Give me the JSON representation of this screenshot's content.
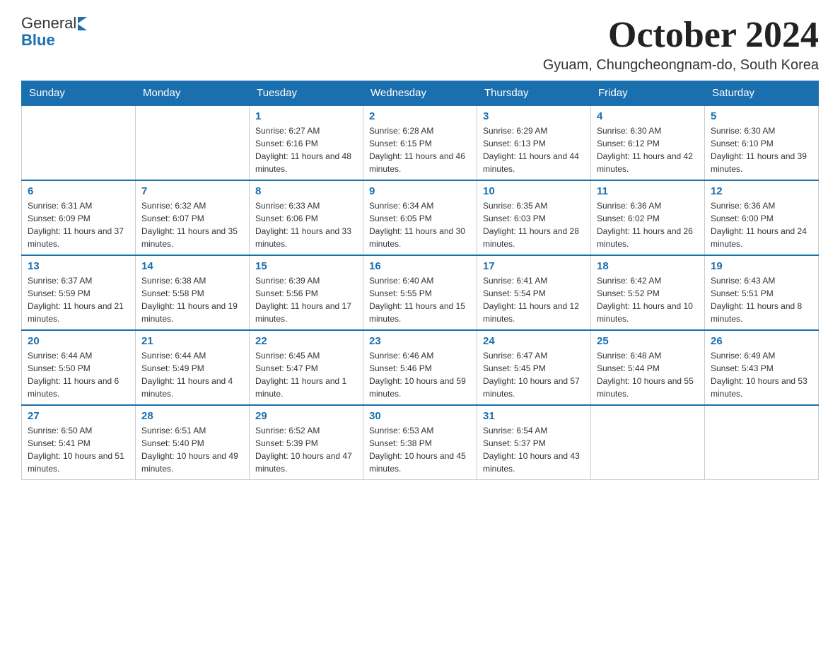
{
  "header": {
    "logo_general": "General",
    "logo_blue": "Blue",
    "main_title": "October 2024",
    "subtitle": "Gyuam, Chungcheongnam-do, South Korea"
  },
  "calendar": {
    "days_of_week": [
      "Sunday",
      "Monday",
      "Tuesday",
      "Wednesday",
      "Thursday",
      "Friday",
      "Saturday"
    ],
    "weeks": [
      [
        {
          "day": "",
          "sunrise": "",
          "sunset": "",
          "daylight": ""
        },
        {
          "day": "",
          "sunrise": "",
          "sunset": "",
          "daylight": ""
        },
        {
          "day": "1",
          "sunrise": "Sunrise: 6:27 AM",
          "sunset": "Sunset: 6:16 PM",
          "daylight": "Daylight: 11 hours and 48 minutes."
        },
        {
          "day": "2",
          "sunrise": "Sunrise: 6:28 AM",
          "sunset": "Sunset: 6:15 PM",
          "daylight": "Daylight: 11 hours and 46 minutes."
        },
        {
          "day": "3",
          "sunrise": "Sunrise: 6:29 AM",
          "sunset": "Sunset: 6:13 PM",
          "daylight": "Daylight: 11 hours and 44 minutes."
        },
        {
          "day": "4",
          "sunrise": "Sunrise: 6:30 AM",
          "sunset": "Sunset: 6:12 PM",
          "daylight": "Daylight: 11 hours and 42 minutes."
        },
        {
          "day": "5",
          "sunrise": "Sunrise: 6:30 AM",
          "sunset": "Sunset: 6:10 PM",
          "daylight": "Daylight: 11 hours and 39 minutes."
        }
      ],
      [
        {
          "day": "6",
          "sunrise": "Sunrise: 6:31 AM",
          "sunset": "Sunset: 6:09 PM",
          "daylight": "Daylight: 11 hours and 37 minutes."
        },
        {
          "day": "7",
          "sunrise": "Sunrise: 6:32 AM",
          "sunset": "Sunset: 6:07 PM",
          "daylight": "Daylight: 11 hours and 35 minutes."
        },
        {
          "day": "8",
          "sunrise": "Sunrise: 6:33 AM",
          "sunset": "Sunset: 6:06 PM",
          "daylight": "Daylight: 11 hours and 33 minutes."
        },
        {
          "day": "9",
          "sunrise": "Sunrise: 6:34 AM",
          "sunset": "Sunset: 6:05 PM",
          "daylight": "Daylight: 11 hours and 30 minutes."
        },
        {
          "day": "10",
          "sunrise": "Sunrise: 6:35 AM",
          "sunset": "Sunset: 6:03 PM",
          "daylight": "Daylight: 11 hours and 28 minutes."
        },
        {
          "day": "11",
          "sunrise": "Sunrise: 6:36 AM",
          "sunset": "Sunset: 6:02 PM",
          "daylight": "Daylight: 11 hours and 26 minutes."
        },
        {
          "day": "12",
          "sunrise": "Sunrise: 6:36 AM",
          "sunset": "Sunset: 6:00 PM",
          "daylight": "Daylight: 11 hours and 24 minutes."
        }
      ],
      [
        {
          "day": "13",
          "sunrise": "Sunrise: 6:37 AM",
          "sunset": "Sunset: 5:59 PM",
          "daylight": "Daylight: 11 hours and 21 minutes."
        },
        {
          "day": "14",
          "sunrise": "Sunrise: 6:38 AM",
          "sunset": "Sunset: 5:58 PM",
          "daylight": "Daylight: 11 hours and 19 minutes."
        },
        {
          "day": "15",
          "sunrise": "Sunrise: 6:39 AM",
          "sunset": "Sunset: 5:56 PM",
          "daylight": "Daylight: 11 hours and 17 minutes."
        },
        {
          "day": "16",
          "sunrise": "Sunrise: 6:40 AM",
          "sunset": "Sunset: 5:55 PM",
          "daylight": "Daylight: 11 hours and 15 minutes."
        },
        {
          "day": "17",
          "sunrise": "Sunrise: 6:41 AM",
          "sunset": "Sunset: 5:54 PM",
          "daylight": "Daylight: 11 hours and 12 minutes."
        },
        {
          "day": "18",
          "sunrise": "Sunrise: 6:42 AM",
          "sunset": "Sunset: 5:52 PM",
          "daylight": "Daylight: 11 hours and 10 minutes."
        },
        {
          "day": "19",
          "sunrise": "Sunrise: 6:43 AM",
          "sunset": "Sunset: 5:51 PM",
          "daylight": "Daylight: 11 hours and 8 minutes."
        }
      ],
      [
        {
          "day": "20",
          "sunrise": "Sunrise: 6:44 AM",
          "sunset": "Sunset: 5:50 PM",
          "daylight": "Daylight: 11 hours and 6 minutes."
        },
        {
          "day": "21",
          "sunrise": "Sunrise: 6:44 AM",
          "sunset": "Sunset: 5:49 PM",
          "daylight": "Daylight: 11 hours and 4 minutes."
        },
        {
          "day": "22",
          "sunrise": "Sunrise: 6:45 AM",
          "sunset": "Sunset: 5:47 PM",
          "daylight": "Daylight: 11 hours and 1 minute."
        },
        {
          "day": "23",
          "sunrise": "Sunrise: 6:46 AM",
          "sunset": "Sunset: 5:46 PM",
          "daylight": "Daylight: 10 hours and 59 minutes."
        },
        {
          "day": "24",
          "sunrise": "Sunrise: 6:47 AM",
          "sunset": "Sunset: 5:45 PM",
          "daylight": "Daylight: 10 hours and 57 minutes."
        },
        {
          "day": "25",
          "sunrise": "Sunrise: 6:48 AM",
          "sunset": "Sunset: 5:44 PM",
          "daylight": "Daylight: 10 hours and 55 minutes."
        },
        {
          "day": "26",
          "sunrise": "Sunrise: 6:49 AM",
          "sunset": "Sunset: 5:43 PM",
          "daylight": "Daylight: 10 hours and 53 minutes."
        }
      ],
      [
        {
          "day": "27",
          "sunrise": "Sunrise: 6:50 AM",
          "sunset": "Sunset: 5:41 PM",
          "daylight": "Daylight: 10 hours and 51 minutes."
        },
        {
          "day": "28",
          "sunrise": "Sunrise: 6:51 AM",
          "sunset": "Sunset: 5:40 PM",
          "daylight": "Daylight: 10 hours and 49 minutes."
        },
        {
          "day": "29",
          "sunrise": "Sunrise: 6:52 AM",
          "sunset": "Sunset: 5:39 PM",
          "daylight": "Daylight: 10 hours and 47 minutes."
        },
        {
          "day": "30",
          "sunrise": "Sunrise: 6:53 AM",
          "sunset": "Sunset: 5:38 PM",
          "daylight": "Daylight: 10 hours and 45 minutes."
        },
        {
          "day": "31",
          "sunrise": "Sunrise: 6:54 AM",
          "sunset": "Sunset: 5:37 PM",
          "daylight": "Daylight: 10 hours and 43 minutes."
        },
        {
          "day": "",
          "sunrise": "",
          "sunset": "",
          "daylight": ""
        },
        {
          "day": "",
          "sunrise": "",
          "sunset": "",
          "daylight": ""
        }
      ]
    ]
  }
}
